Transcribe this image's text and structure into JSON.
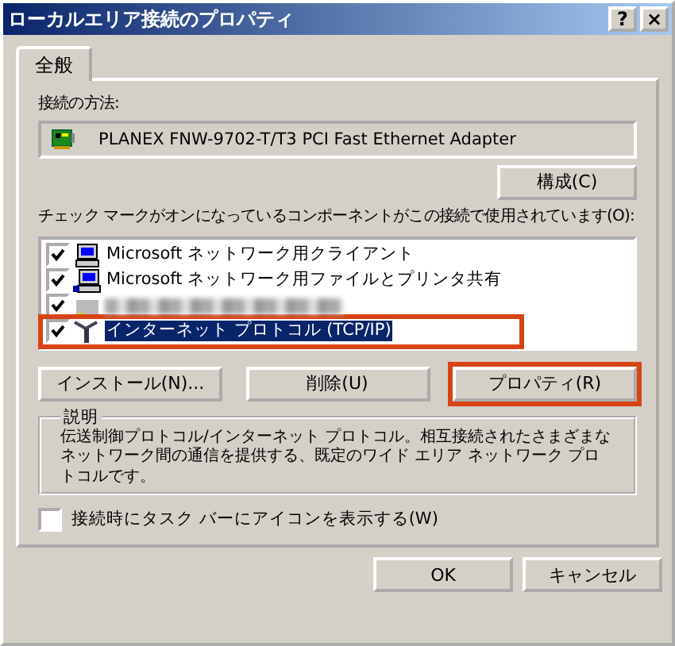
{
  "window": {
    "title": "ローカルエリア接続のプロパティ",
    "help_button": "?",
    "close_button": "×"
  },
  "tabs": [
    {
      "label": "全般",
      "selected": true
    }
  ],
  "connect_using": {
    "label": "接続の方法:",
    "adapter": "PLANEX FNW-9702-T/T3 PCI Fast Ethernet Adapter",
    "configure_button": "構成(C)"
  },
  "components": {
    "label": "チェック マークがオンになっているコンポーネントがこの接続で使用されています(O):",
    "items": [
      {
        "kind": "client",
        "label": "Microsoft ネットワーク用クライアント",
        "checked": true,
        "selected": false,
        "highlighted": false
      },
      {
        "kind": "share",
        "label": "Microsoft ネットワーク用ファイルとプリンタ共有",
        "checked": true,
        "selected": false,
        "highlighted": false
      },
      {
        "kind": "blurred",
        "checked": true,
        "selected": false,
        "highlighted": false
      },
      {
        "kind": "protocol",
        "label": "インターネット プロトコル (TCP/IP)",
        "checked": true,
        "selected": true,
        "highlighted": true
      }
    ]
  },
  "buttons": [
    {
      "label": "インストール(N)...",
      "highlighted": false
    },
    {
      "label": "削除(U)",
      "highlighted": false
    },
    {
      "label": "プロパティ(R)",
      "highlighted": true
    }
  ],
  "description": {
    "title": "説明",
    "text": "伝送制御プロトコル/インターネット プロトコル。相互接続されたさまざまなネットワーク間の通信を提供する、既定のワイド エリア ネットワーク プロトコルです。"
  },
  "show_icon": {
    "label": "接続時にタスク バーにアイコンを表示する(W)",
    "checked": false
  },
  "dialog_buttons": [
    "OK",
    "キャンセル"
  ]
}
